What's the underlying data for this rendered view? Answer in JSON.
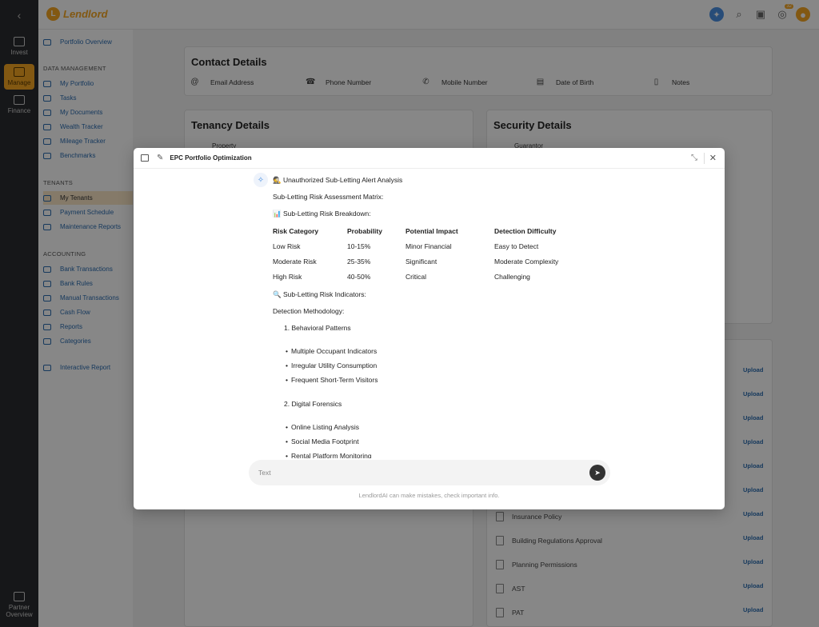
{
  "app": {
    "name": "Lendlord",
    "logo_letter": "L"
  },
  "topbar": {
    "notification_count": "32"
  },
  "rail": {
    "back_icon": "chevron-left",
    "items": [
      {
        "label": "Invest"
      },
      {
        "label": "Manage"
      },
      {
        "label": "Finance"
      },
      {
        "label": "Partner Overview"
      }
    ]
  },
  "sidenav": {
    "top_item": "Portfolio Overview",
    "sections": [
      {
        "title": "DATA MANAGEMENT",
        "items": [
          "My Portfolio",
          "Tasks",
          "My Documents",
          "Wealth Tracker",
          "Mileage Tracker",
          "Benchmarks"
        ]
      },
      {
        "title": "TENANTS",
        "items": [
          "My Tenants",
          "Payment Schedule",
          "Maintenance Reports"
        ]
      },
      {
        "title": "ACCOUNTING",
        "items": [
          "Bank Transactions",
          "Bank Rules",
          "Manual Transactions",
          "Cash Flow",
          "Reports",
          "Categories"
        ]
      }
    ],
    "bottom_item": "Interactive Report"
  },
  "page": {
    "contact": {
      "title": "Contact Details",
      "fields": [
        "Email Address",
        "Phone Number",
        "Mobile Number",
        "Date of Birth",
        "Notes"
      ]
    },
    "tenancy": {
      "title": "Tenancy Details",
      "first_field": "Property"
    },
    "security": {
      "title": "Security Details",
      "first_field": "Guarantor"
    },
    "documents": [
      "Insurance Policy",
      "Building Regulations Approval",
      "Planning Permissions",
      "AST",
      "PAT"
    ],
    "upload_label": "Upload"
  },
  "modal": {
    "title": "EPC Portfolio Optimization",
    "heading": "🕵️ Unauthorized Sub-Letting Alert Analysis",
    "subheading": "Sub-Letting Risk Assessment Matrix:",
    "breakdown_title": "📊 Sub-Letting Risk Breakdown:",
    "table": {
      "headers": [
        "Risk Category",
        "Probability",
        "Potential Impact",
        "Detection Difficulty"
      ],
      "rows": [
        [
          "Low Risk",
          "10-15%",
          "Minor Financial",
          "Easy to Detect"
        ],
        [
          "Moderate Risk",
          "25-35%",
          "Significant",
          "Moderate Complexity"
        ],
        [
          "High Risk",
          "40-50%",
          "Critical",
          "Challenging"
        ]
      ]
    },
    "indicators_title": "🔍 Sub-Letting Risk Indicators:",
    "methodology_title": "Detection Methodology:",
    "groups": [
      {
        "title": "1. Behavioral Patterns",
        "items": [
          "Multiple Occupant Indicators",
          "Irregular Utility Consumption",
          "Frequent Short-Term Visitors"
        ]
      },
      {
        "title": "2. Digital Forensics",
        "items": [
          "Online Listing Analysis",
          "Social Media Footprint",
          "Rental Platform Monitoring"
        ]
      }
    ],
    "input_placeholder": "Text",
    "disclaimer": "LendlordAI can make mistakes, check important info."
  }
}
